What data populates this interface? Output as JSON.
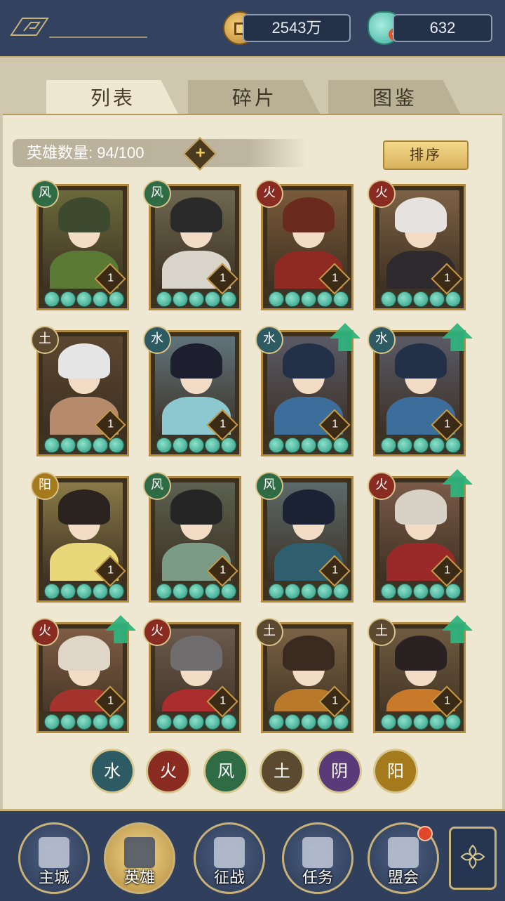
{
  "resources": {
    "gold": "2543万",
    "gems": "632"
  },
  "tabs": [
    "列表",
    "碎片",
    "图鉴"
  ],
  "hero_count_label": "英雄数量: 94/100",
  "sort_label": "排序",
  "heroes": [
    {
      "element": "风",
      "level": "1",
      "upgrade": false,
      "hair": "#3e4a2e",
      "body": "#5a7a36",
      "bg": "#6b6a3b"
    },
    {
      "element": "风",
      "level": "1",
      "upgrade": false,
      "hair": "#2a2a2a",
      "body": "#d8d4c9",
      "bg": "#6f6850"
    },
    {
      "element": "火",
      "level": "1",
      "upgrade": false,
      "hair": "#6b2a1e",
      "body": "#8e2a22",
      "bg": "#7a5a3a"
    },
    {
      "element": "火",
      "level": "1",
      "upgrade": false,
      "hair": "#e6e2e0",
      "body": "#2e2a2d",
      "bg": "#7d6145"
    },
    {
      "element": "土",
      "level": "1",
      "upgrade": false,
      "hair": "#e5e5e5",
      "body": "#b58b6b",
      "bg": "#5c4630"
    },
    {
      "element": "水",
      "level": "1",
      "upgrade": false,
      "hair": "#1d1f2e",
      "body": "#8dc8d0",
      "bg": "#60747c"
    },
    {
      "element": "水",
      "level": "1",
      "upgrade": true,
      "hair": "#223048",
      "body": "#3d6d9b",
      "bg": "#5a5a66"
    },
    {
      "element": "水",
      "level": "1",
      "upgrade": true,
      "hair": "#223048",
      "body": "#3d6d9b",
      "bg": "#5a5a66"
    },
    {
      "element": "阳",
      "level": "1",
      "upgrade": false,
      "hair": "#2a2320",
      "body": "#e8d87a",
      "bg": "#8a7a48"
    },
    {
      "element": "风",
      "level": "1",
      "upgrade": false,
      "hair": "#252525",
      "body": "#7c9b87",
      "bg": "#5c6150"
    },
    {
      "element": "风",
      "level": "1",
      "upgrade": false,
      "hair": "#1b2233",
      "body": "#2f5f6e",
      "bg": "#5c6a6a"
    },
    {
      "element": "火",
      "level": "1",
      "upgrade": true,
      "hair": "#d8d2c6",
      "body": "#9a2a2a",
      "bg": "#7a5a48"
    },
    {
      "element": "火",
      "level": "1",
      "upgrade": true,
      "hair": "#e0d6c8",
      "body": "#a3332c",
      "bg": "#7e5c44"
    },
    {
      "element": "火",
      "level": "1",
      "upgrade": false,
      "hair": "#6f6d6d",
      "body": "#ab2c2c",
      "bg": "#6b5a4d"
    },
    {
      "element": "土",
      "level": "1",
      "upgrade": false,
      "hair": "#3a2a20",
      "body": "#b87a2a",
      "bg": "#7a6245"
    },
    {
      "element": "土",
      "level": "1",
      "upgrade": true,
      "hair": "#2a2222",
      "body": "#c9792a",
      "bg": "#6e5a40"
    }
  ],
  "element_filters": [
    {
      "label": "水",
      "color": "#2e5a63"
    },
    {
      "label": "火",
      "color": "#8a2b22"
    },
    {
      "label": "风",
      "color": "#2f6b44"
    },
    {
      "label": "土",
      "color": "#5b4a30"
    },
    {
      "label": "阴",
      "color": "#5b3a7a"
    },
    {
      "label": "阳",
      "color": "#a57a1c"
    }
  ],
  "element_colors": {
    "风": "#2f6b44",
    "火": "#8a2b22",
    "土": "#5b4a30",
    "水": "#2e5a63",
    "阳": "#a57a1c",
    "阴": "#5b3a7a"
  },
  "nav": [
    {
      "label": "主城",
      "icon": "castle-icon",
      "active": false,
      "dot": false
    },
    {
      "label": "英雄",
      "icon": "hero-icon",
      "active": true,
      "dot": false
    },
    {
      "label": "征战",
      "icon": "battle-icon",
      "active": false,
      "dot": false
    },
    {
      "label": "任务",
      "icon": "task-icon",
      "active": false,
      "dot": false
    },
    {
      "label": "盟会",
      "icon": "guild-icon",
      "active": false,
      "dot": true
    }
  ]
}
